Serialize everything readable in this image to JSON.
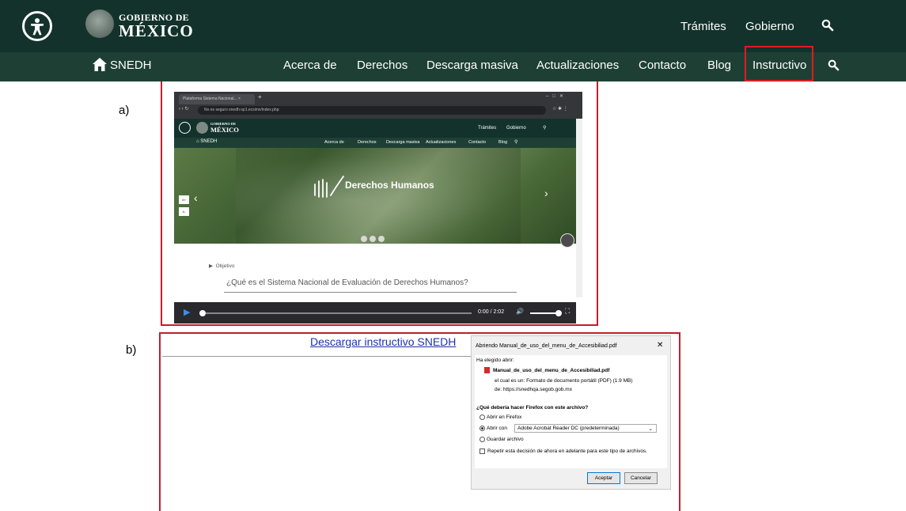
{
  "top_bar": {
    "gov_line1": "GOBIERNO DE",
    "gov_line2": "MÉXICO",
    "links": [
      "Trámites",
      "Gobierno"
    ]
  },
  "nav": {
    "brand": "SNEDH",
    "items": [
      "Acerca de",
      "Derechos",
      "Descarga masiva",
      "Actualizaciones",
      "Contacto",
      "Blog",
      "Instructivo"
    ],
    "active": "Instructivo"
  },
  "captions": {
    "a": "a)",
    "b": "b)"
  },
  "screenshot_a": {
    "tab_title": "Plataforma Sistema Nacional... ×",
    "url": "No es seguro   snedh-sp1.ecsimx/index.php",
    "gov_line1": "GOBIERNO DE",
    "gov_line2": "MÉXICO",
    "top_links": [
      "Trámites",
      "Gobierno"
    ],
    "brand": "SNEDH",
    "nav_items": [
      "Acerca de",
      "Derechos",
      "Descarga masiva",
      "Actualizaciones",
      "Contacto",
      "Blog"
    ],
    "hero_title": "Derechos Humanos",
    "font_buttons": [
      "A+",
      "A-"
    ],
    "objetivo": "Objetivo",
    "question": "¿Qué es el Sistema Nacional de Evaluación de Derechos Humanos?",
    "time": "0:00 / 2:02"
  },
  "screenshot_b": {
    "download_link": "Descargar instructivo SNEDH",
    "dialog": {
      "title": "Abriendo Manual_de_uso_del_menu_de_Accesibiliad.pdf",
      "chosen_label": "Ha elegido abrir:",
      "file_name": "Manual_de_uso_del_menu_de_Accesibiliad.pdf",
      "type_label": "el cual es un:",
      "type_value": "Formato de documento portátil (PDF) (1.9 MB)",
      "from_label": "de:",
      "from_value": "https://snedhqa.segob.gob.mx",
      "question": "¿Qué debería hacer Firefox con este archivo?",
      "option_open_firefox": "Abrir en Firefox",
      "option_open_with": "Abrir con",
      "open_with_app": "Adobe Acrobat Reader DC (predeterminada)",
      "option_save": "Guardar archivo",
      "remember": "Repetir esta decisión de ahora en adelante para este tipo de archivos.",
      "accept": "Aceptar",
      "cancel": "Cancelar"
    }
  }
}
